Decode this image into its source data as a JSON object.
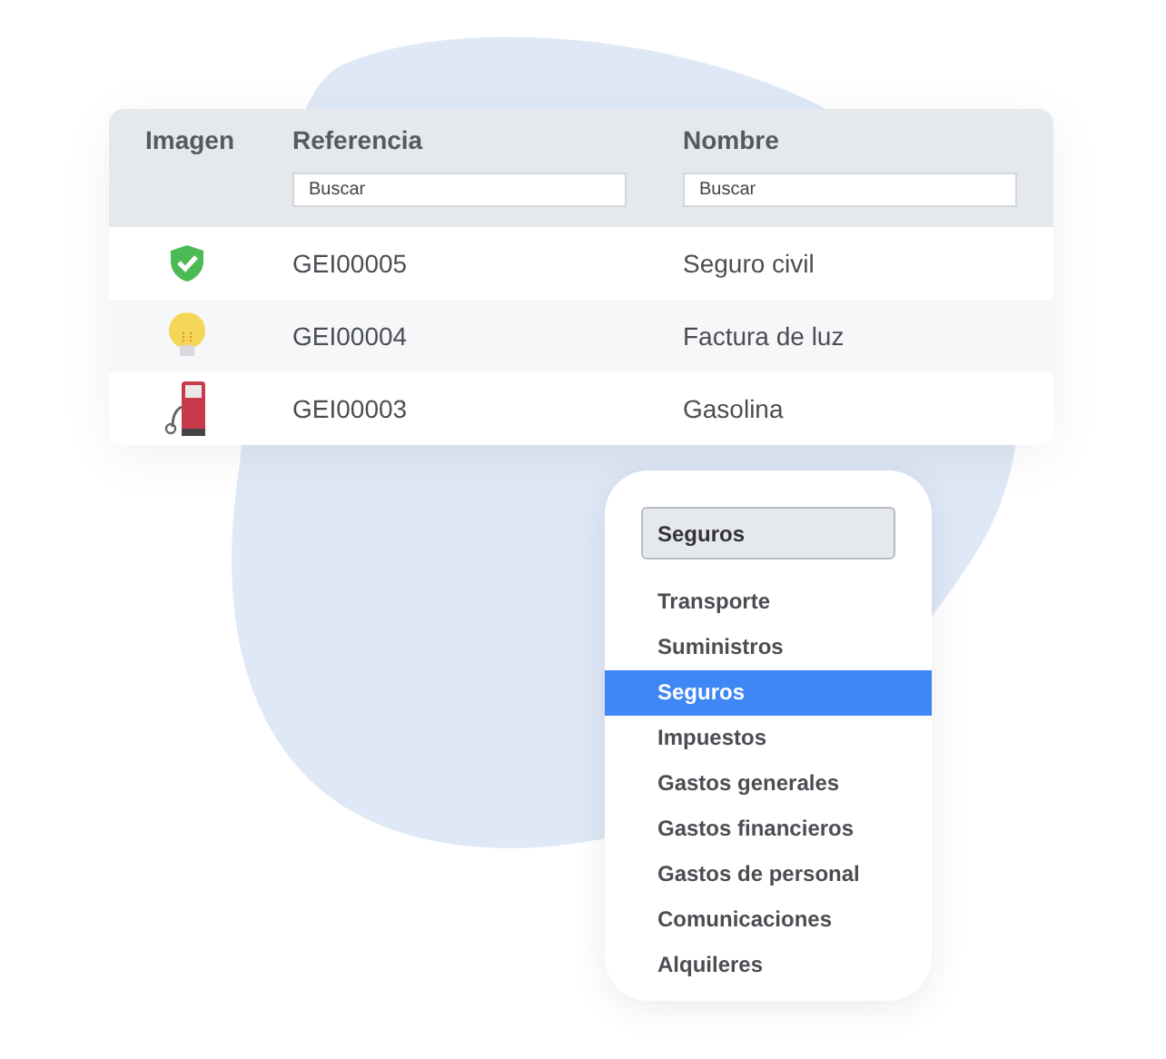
{
  "table": {
    "columns": [
      {
        "label": "Imagen"
      },
      {
        "label": "Referencia",
        "search_placeholder": "Buscar"
      },
      {
        "label": "Nombre",
        "search_placeholder": "Buscar"
      }
    ],
    "rows": [
      {
        "kind": "shield",
        "reference": "GEI00005",
        "name": "Seguro civil"
      },
      {
        "kind": "bulb",
        "reference": "GEI00004",
        "name": "Factura de luz"
      },
      {
        "kind": "pump",
        "reference": "GEI00003",
        "name": "Gasolina"
      }
    ]
  },
  "dropdown": {
    "value": "Seguros",
    "options": [
      {
        "label": "Transporte",
        "selected": false
      },
      {
        "label": "Suministros",
        "selected": false
      },
      {
        "label": "Seguros",
        "selected": true
      },
      {
        "label": "Impuestos",
        "selected": false
      },
      {
        "label": "Gastos generales",
        "selected": false
      },
      {
        "label": "Gastos financieros",
        "selected": false
      },
      {
        "label": "Gastos de personal",
        "selected": false
      },
      {
        "label": "Comunicaciones",
        "selected": false
      },
      {
        "label": "Alquileres",
        "selected": false
      }
    ]
  }
}
